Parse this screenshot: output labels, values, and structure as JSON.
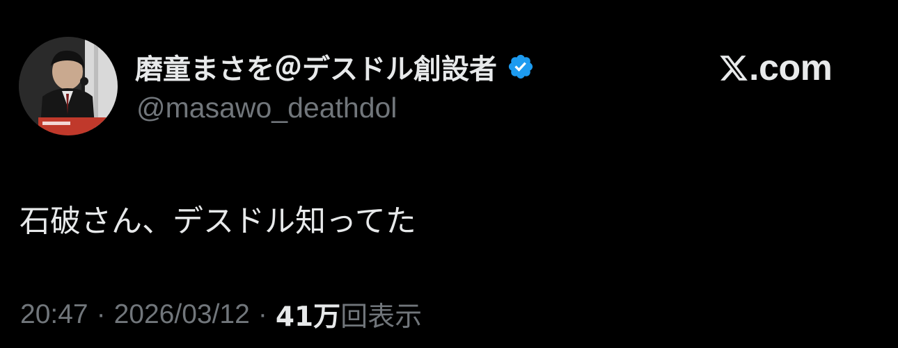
{
  "header": {
    "display_name": "磨童まさを＠デスドル創設者",
    "handle": "@masawo_deathdol",
    "avatar_icon": "avatar-icon",
    "verified_icon": "verified-badge-icon",
    "verified_color": "#1d9bf0"
  },
  "brand": {
    "icon": "x-logo-icon",
    "label": ".com"
  },
  "tweet": {
    "text": "石破さん、デスドル知ってた"
  },
  "meta": {
    "time": "20:47",
    "separator_1": "·",
    "date": "2026/03/12",
    "separator_2": "·",
    "views_count": "41万",
    "views_label": "回表示"
  },
  "colors": {
    "background": "#000000",
    "primary_text": "#e7e9ea",
    "secondary_text": "#71767b"
  }
}
